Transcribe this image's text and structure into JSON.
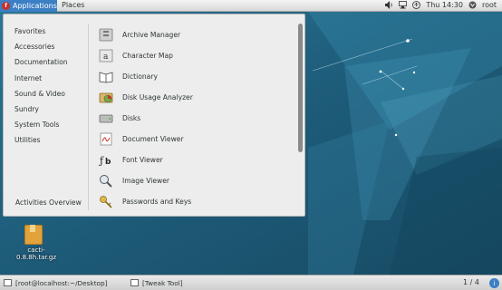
{
  "top_panel": {
    "applications_label": "Applications",
    "places_label": "Places",
    "clock": "Thu 14:30",
    "user": "root"
  },
  "menu": {
    "categories": [
      "Favorites",
      "Accessories",
      "Documentation",
      "Internet",
      "Sound & Video",
      "Sundry",
      "System Tools",
      "Utilities"
    ],
    "activities": "Activities Overview",
    "apps": [
      {
        "label": "Archive Manager",
        "icon": "archive-manager-icon"
      },
      {
        "label": "Character Map",
        "icon": "character-map-icon"
      },
      {
        "label": "Dictionary",
        "icon": "dictionary-icon"
      },
      {
        "label": "Disk Usage Analyzer",
        "icon": "disk-usage-icon"
      },
      {
        "label": "Disks",
        "icon": "disks-icon"
      },
      {
        "label": "Document Viewer",
        "icon": "document-viewer-icon"
      },
      {
        "label": "Font Viewer",
        "icon": "font-viewer-icon"
      },
      {
        "label": "Image Viewer",
        "icon": "image-viewer-icon"
      },
      {
        "label": "Passwords and Keys",
        "icon": "passwords-keys-icon"
      }
    ]
  },
  "desktop": {
    "file_name": "cacti-0.8.8h.tar.gz"
  },
  "taskbar": {
    "task1": "[root@localhost:~/Desktop]",
    "task2": "[Tweak Tool]",
    "pager": "1 / 4"
  },
  "colors": {
    "accent": "#3d7fc4",
    "desktop_bg": "#1f5f7c"
  }
}
